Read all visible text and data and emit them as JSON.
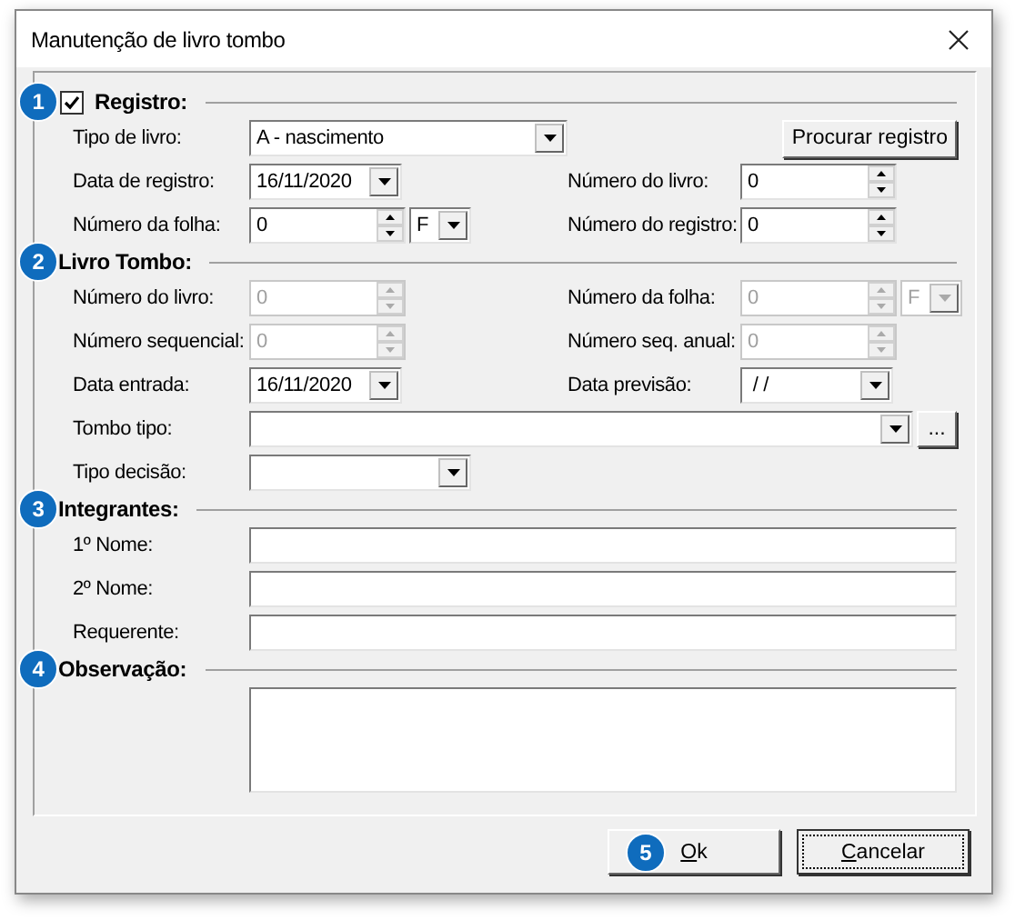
{
  "window": {
    "title": "Manutenção de livro tombo"
  },
  "sections": [
    {
      "badge": "1",
      "title": "Registro:",
      "checked": true,
      "rows": [
        [
          {
            "label": "Tipo de livro:",
            "kind": "long_combo",
            "value": "A - nascimento",
            "disabled": false
          },
          {
            "kind": "button",
            "label": "Procurar registro"
          }
        ],
        [
          {
            "label": "Data de registro:",
            "kind": "date",
            "value": "16/11/2020",
            "disabled": false
          },
          {
            "label": "Número do livro:",
            "kind": "spin",
            "value": "0",
            "disabled": false
          }
        ],
        [
          {
            "label": "Número da folha:",
            "kind": "spin",
            "value": "0",
            "suffix": "F",
            "disabled": false
          },
          {
            "label": "Número do registro:",
            "kind": "spin",
            "value": "0",
            "disabled": false
          }
        ]
      ]
    },
    {
      "badge": "2",
      "title": "Livro Tombo:",
      "rows": [
        [
          {
            "label": "Número do livro:",
            "kind": "spin",
            "value": "0",
            "disabled": true
          },
          {
            "label": "Número da folha:",
            "kind": "spin",
            "value": "0",
            "suffix": "F",
            "disabled": true
          }
        ],
        [
          {
            "label": "Número sequencial:",
            "kind": "spin",
            "value": "0",
            "disabled": true
          },
          {
            "label": "Número seq. anual:",
            "kind": "spin",
            "value": "0",
            "disabled": true
          }
        ],
        [
          {
            "label": "Data entrada:",
            "kind": "date",
            "value": "16/11/2020",
            "disabled": false
          },
          {
            "label": "Data previsão:",
            "kind": "date",
            "value": " / /",
            "disabled": false
          }
        ],
        [
          {
            "label": "Tombo tipo:",
            "kind": "lookup_combo",
            "button": "...",
            "disabled": false
          }
        ],
        [
          {
            "label": "Tipo decisão:",
            "kind": "combo",
            "disabled": false
          }
        ]
      ]
    },
    {
      "badge": "3",
      "title": "Integrantes:",
      "rows": [
        [
          {
            "label": "1º Nome:",
            "kind": "text",
            "disabled": false
          }
        ],
        [
          {
            "label": "2º Nome:",
            "kind": "text",
            "disabled": false
          }
        ],
        [
          {
            "label": "Requerente:",
            "kind": "text",
            "disabled": false
          }
        ]
      ]
    },
    {
      "badge": "4",
      "title": "Observação:",
      "rows": [
        [
          {
            "kind": "memo",
            "disabled": false
          }
        ]
      ]
    }
  ],
  "buttons": [
    {
      "label": "Ok",
      "badge": "5",
      "focused": false
    },
    {
      "label": "Cancelar",
      "focused": true
    }
  ]
}
